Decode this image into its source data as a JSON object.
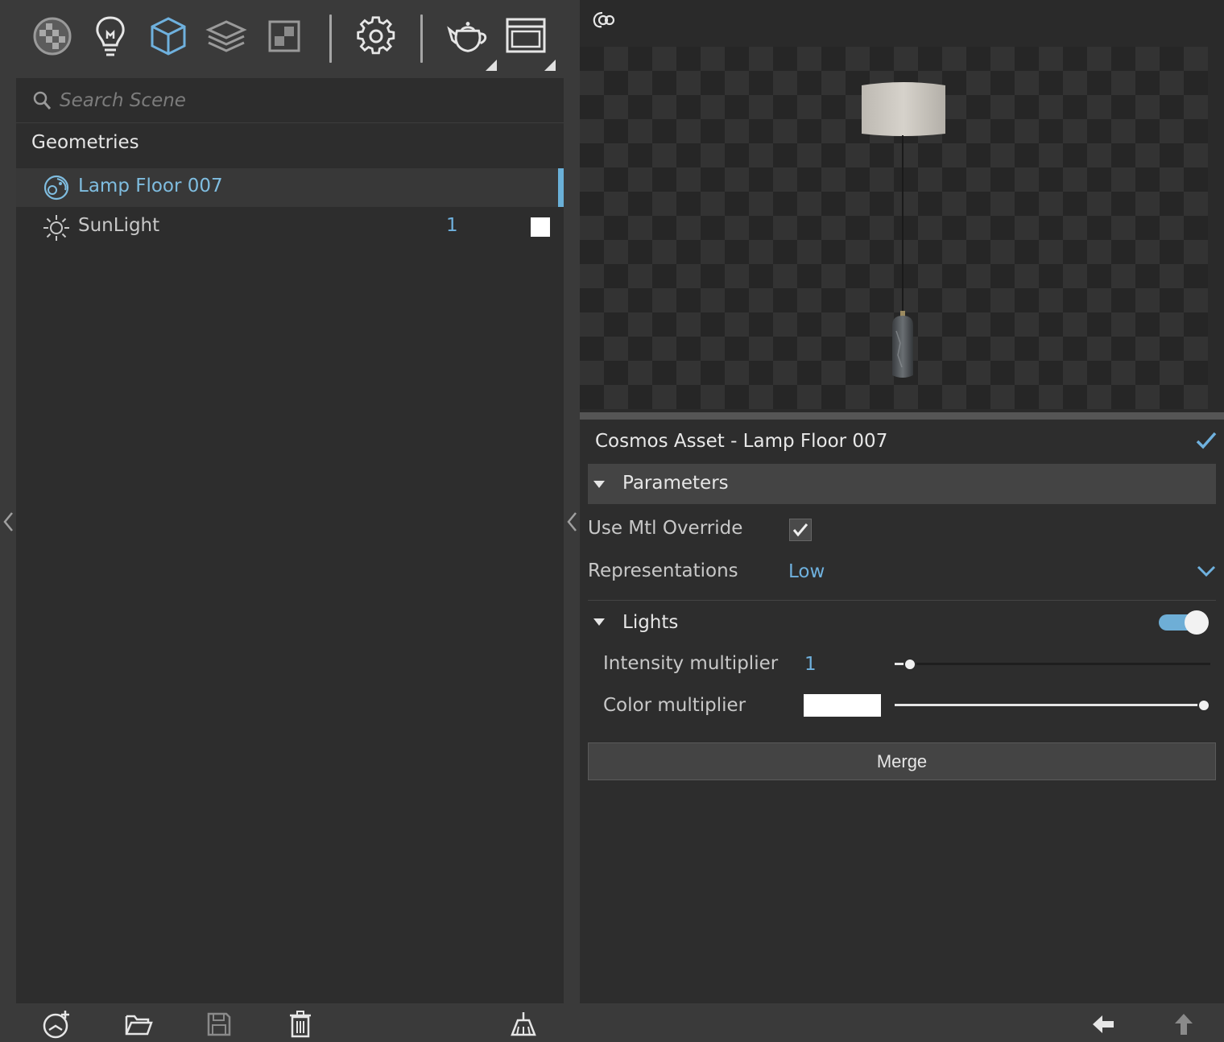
{
  "toolbar": {
    "icons": [
      "material-editor-icon",
      "light-bulb-icon",
      "geometry-cube-icon",
      "layers-icon",
      "render-elements-icon",
      "settings-gear-icon",
      "teapot-render-icon",
      "frame-buffer-icon"
    ]
  },
  "scene": {
    "search_placeholder": "Search Scene",
    "section_label": "Geometries",
    "items": [
      {
        "label": "Lamp Floor 007",
        "icon": "cosmos-asset-icon",
        "selected": true
      },
      {
        "label": "SunLight",
        "icon": "sun-icon",
        "count": "1",
        "swatch_color": "#ffffff"
      }
    ]
  },
  "properties": {
    "title": "Cosmos Asset - Lamp Floor 007",
    "parameters_label": "Parameters",
    "use_mtl_override_label": "Use Mtl Override",
    "use_mtl_override_checked": true,
    "representations_label": "Representations",
    "representations_value": "Low",
    "lights_label": "Lights",
    "lights_enabled": true,
    "intensity_label": "Intensity multiplier",
    "intensity_value": "1",
    "intensity_slider_fraction": 0.03,
    "color_label": "Color multiplier",
    "color_value": "#ffffff",
    "color_slider_fraction": 1.0,
    "merge_label": "Merge"
  },
  "colors": {
    "accent": "#6fb1de",
    "panel": "#2d2d2d",
    "chrome": "#3a3a3a"
  }
}
